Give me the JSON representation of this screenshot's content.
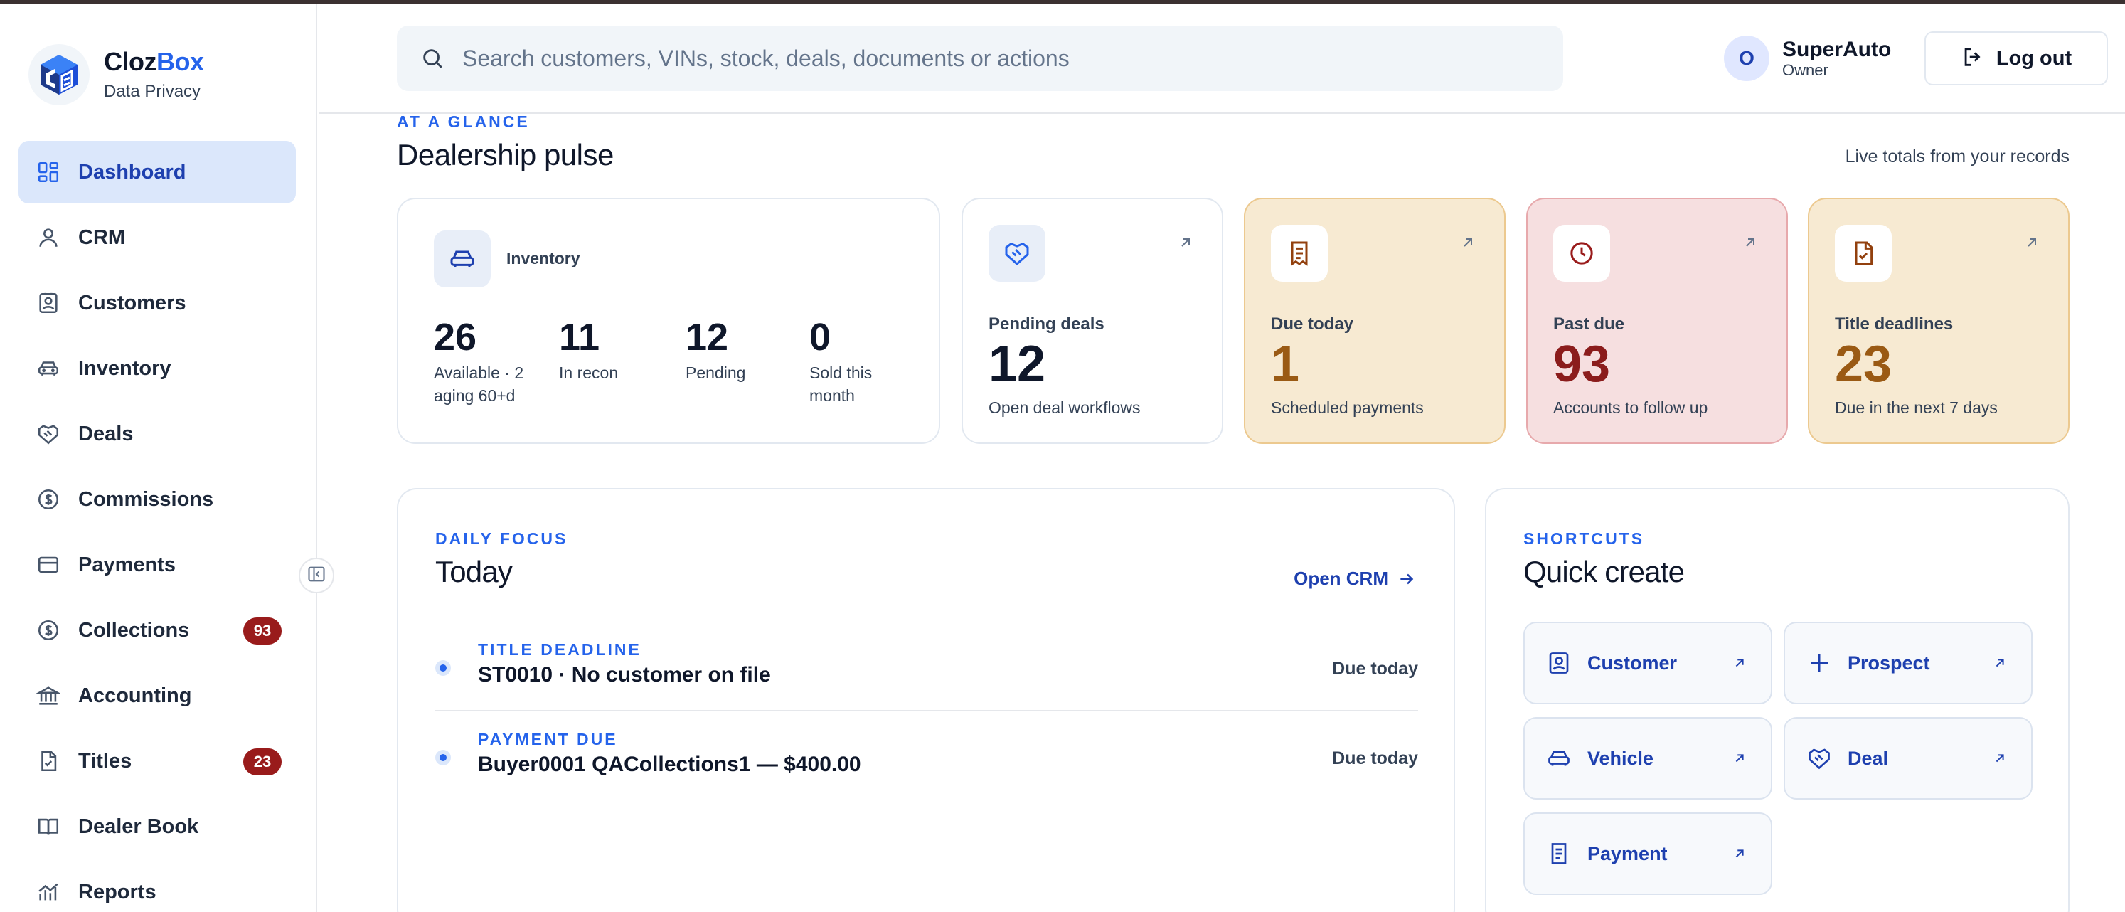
{
  "brand": {
    "name_main": "Cloz",
    "name_accent": "Box",
    "subtitle": "Data Privacy"
  },
  "sidebar": {
    "items": [
      {
        "label": "Dashboard",
        "icon": "grid-icon",
        "active": true
      },
      {
        "label": "CRM",
        "icon": "user-icon"
      },
      {
        "label": "Customers",
        "icon": "contact-icon"
      },
      {
        "label": "Inventory",
        "icon": "car-icon"
      },
      {
        "label": "Deals",
        "icon": "handshake-icon"
      },
      {
        "label": "Commissions",
        "icon": "dollar-circle-icon"
      },
      {
        "label": "Payments",
        "icon": "wallet-icon"
      },
      {
        "label": "Collections",
        "icon": "dollar-circle-icon",
        "badge": "93"
      },
      {
        "label": "Accounting",
        "icon": "bank-icon"
      },
      {
        "label": "Titles",
        "icon": "file-check-icon",
        "badge": "23"
      },
      {
        "label": "Dealer Book",
        "icon": "book-icon"
      },
      {
        "label": "Reports",
        "icon": "chart-icon"
      }
    ]
  },
  "search": {
    "placeholder": "Search customers, VINs, stock, deals, documents or actions"
  },
  "user": {
    "initial": "O",
    "name": "SuperAuto",
    "role": "Owner"
  },
  "logout_label": "Log out",
  "pulse": {
    "eyebrow": "AT A GLANCE",
    "title": "Dealership pulse",
    "note": "Live totals from your records"
  },
  "inventory": {
    "title": "Inventory",
    "stats": [
      {
        "value": "26",
        "label": "Available · 2 aging 60+d"
      },
      {
        "value": "11",
        "label": "In recon"
      },
      {
        "value": "12",
        "label": "Pending"
      },
      {
        "value": "0",
        "label": "Sold this month"
      }
    ]
  },
  "kpis": [
    {
      "label": "Pending deals",
      "value": "12",
      "sub": "Open deal workflows",
      "theme": "blue"
    },
    {
      "label": "Due today",
      "value": "1",
      "sub": "Scheduled payments",
      "theme": "amber"
    },
    {
      "label": "Past due",
      "value": "93",
      "sub": "Accounts to follow up",
      "theme": "red"
    },
    {
      "label": "Title deadlines",
      "value": "23",
      "sub": "Due in the next 7 days",
      "theme": "amber"
    }
  ],
  "today": {
    "eyebrow": "DAILY FOCUS",
    "title": "Today",
    "open_crm": "Open CRM",
    "tasks": [
      {
        "type": "TITLE DEADLINE",
        "title": "ST0010 · No customer on file",
        "due": "Due today"
      },
      {
        "type": "PAYMENT DUE",
        "title": "Buyer0001 QACollections1 — $400.00",
        "due": "Due today"
      }
    ]
  },
  "quick": {
    "eyebrow": "SHORTCUTS",
    "title": "Quick create",
    "items": [
      {
        "label": "Customer",
        "icon": "contact-icon"
      },
      {
        "label": "Prospect",
        "icon": "plus-icon"
      },
      {
        "label": "Vehicle",
        "icon": "car-icon"
      },
      {
        "label": "Deal",
        "icon": "handshake-icon"
      },
      {
        "label": "Payment",
        "icon": "receipt-icon"
      }
    ]
  },
  "colors": {
    "accent": "#2563eb",
    "badge": "#991b1b",
    "amber_card": "#f7ead2",
    "red_card": "#f6dfe0"
  }
}
